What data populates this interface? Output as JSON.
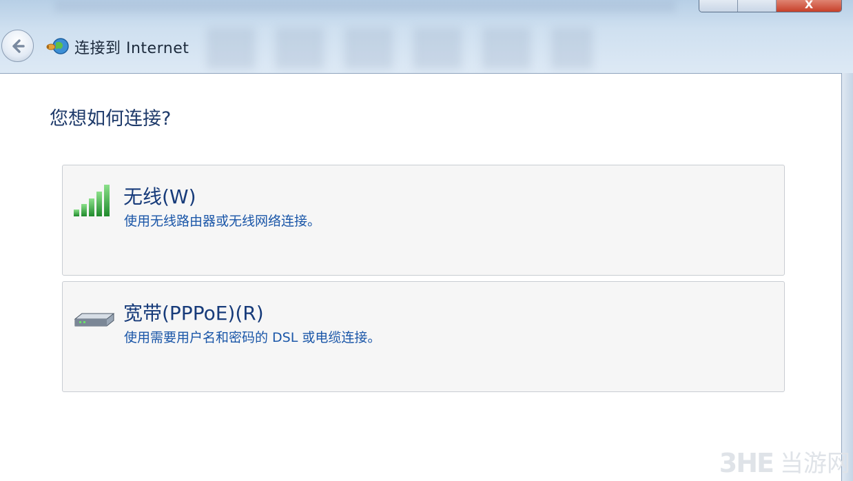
{
  "window": {
    "title": "连接到 Internet",
    "close_label": "X"
  },
  "main": {
    "question": "您想如何连接?",
    "options": [
      {
        "title": "无线(W)",
        "description": "使用无线路由器或无线网络连接。",
        "icon": "wireless-signal-icon"
      },
      {
        "title": "宽带(PPPoE)(R)",
        "description": "使用需要用户名和密码的 DSL 或电缆连接。",
        "icon": "modem-icon"
      }
    ]
  },
  "watermark": {
    "logo": "3HE",
    "text": "当游网"
  },
  "colors": {
    "title_blue": "#1e3a6a",
    "link_blue": "#1a56a8",
    "signal_green": "#2fa33b"
  }
}
